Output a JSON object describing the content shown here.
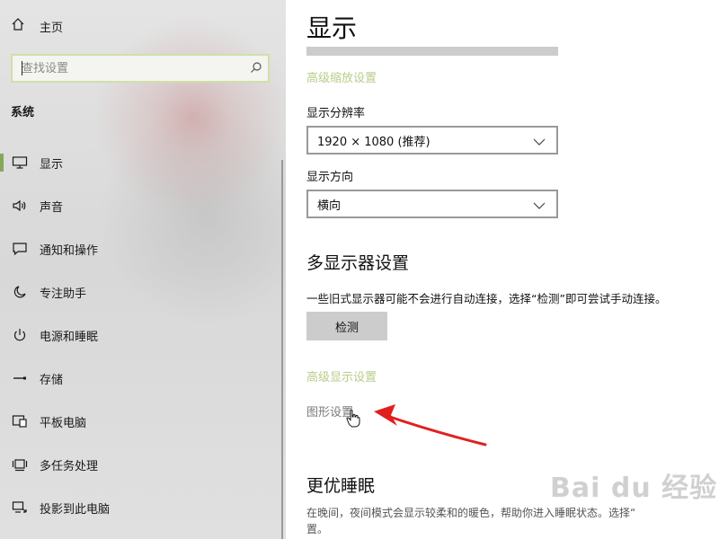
{
  "sidebar": {
    "home_label": "主页",
    "search_placeholder": "查找设置",
    "section_title": "系统",
    "items": [
      {
        "label": "显示",
        "icon": "monitor-icon"
      },
      {
        "label": "声音",
        "icon": "speaker-icon"
      },
      {
        "label": "通知和操作",
        "icon": "notification-icon"
      },
      {
        "label": "专注助手",
        "icon": "moon-icon"
      },
      {
        "label": "电源和睡眠",
        "icon": "power-icon"
      },
      {
        "label": "存储",
        "icon": "storage-icon"
      },
      {
        "label": "平板电脑",
        "icon": "tablet-icon"
      },
      {
        "label": "多任务处理",
        "icon": "multitask-icon"
      },
      {
        "label": "投影到此电脑",
        "icon": "project-icon"
      }
    ]
  },
  "main": {
    "title": "显示",
    "advanced_scaling_link": "高级缩放设置",
    "resolution_label": "显示分辨率",
    "resolution_value": "1920 × 1080 (推荐)",
    "orientation_label": "显示方向",
    "orientation_value": "横向",
    "multi_display_heading": "多显示器设置",
    "multi_display_desc": "一些旧式显示器可能不会进行自动连接，选择“检测”即可尝试手动连接。",
    "detect_button": "检测",
    "advanced_display_link": "高级显示设置",
    "graphics_settings_link": "图形设置",
    "sleep_heading": "更优睡眠",
    "sleep_desc_line1": "在晚间，夜间模式会显示较柔和的暖色，帮助你进入睡眠状态。选择“",
    "sleep_desc_line2": "置。"
  },
  "watermark": "Bai du 经验",
  "colors": {
    "accent_green": "#86a85a",
    "link_green": "#b8cc8a",
    "arrow_red": "#e02020"
  }
}
